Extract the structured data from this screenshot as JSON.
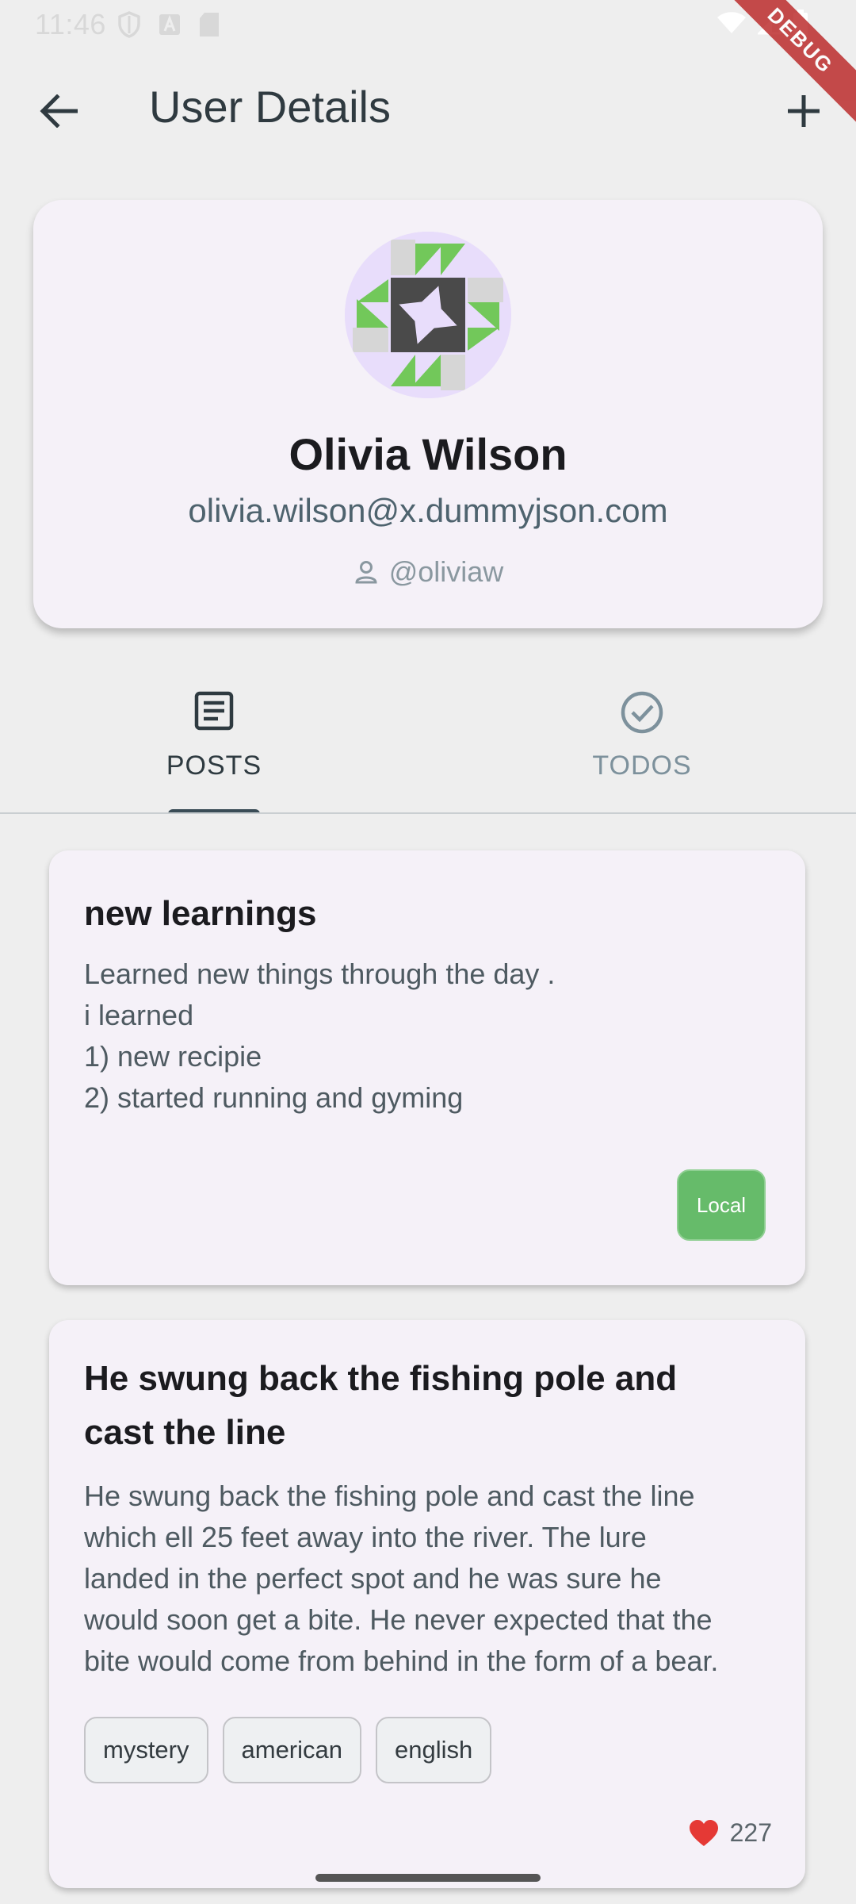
{
  "status_bar": {
    "time": "11:46",
    "icons_left": [
      "shield-icon",
      "a-icon",
      "sd-card-icon"
    ],
    "icons_right": [
      "wifi-icon",
      "signal-icon",
      "battery-icon"
    ]
  },
  "debug_banner": "DEBUG",
  "app_bar": {
    "title": "User Details",
    "back_icon": "arrow-left-icon",
    "add_icon": "plus-icon"
  },
  "profile": {
    "name": "Olivia Wilson",
    "email": "olivia.wilson@x.dummyjson.com",
    "username": "@oliviaw",
    "avatar_colors": {
      "bg": "#e8ddfb",
      "green": "#72c85a",
      "dark": "#4a4a4a",
      "gray": "#d6d6d6"
    }
  },
  "tabs": [
    {
      "label": "POSTS",
      "icon": "article-icon",
      "selected": true
    },
    {
      "label": "TODOS",
      "icon": "check-circle-icon",
      "selected": false
    }
  ],
  "posts": [
    {
      "title": "new learnings",
      "body_lines": [
        "Learned new things through the day .",
        "i learned",
        "1) new recipie",
        "2) started running and gyming"
      ],
      "badge": "Local",
      "badge_color": "#66bb6a"
    },
    {
      "title_lines": [
        "He swung back the fishing pole and",
        "cast the line"
      ],
      "body_lines": [
        "He swung back the fishing pole and cast the line",
        "which ell 25 feet away into the river. The lure",
        "landed in the perfect spot and he was sure he",
        "would soon get a bite. He never expected that the",
        "bite would come from behind in the form of a bear."
      ],
      "tags": [
        "mystery",
        "american",
        "english"
      ],
      "likes": "227",
      "like_color": "#e53935"
    }
  ]
}
